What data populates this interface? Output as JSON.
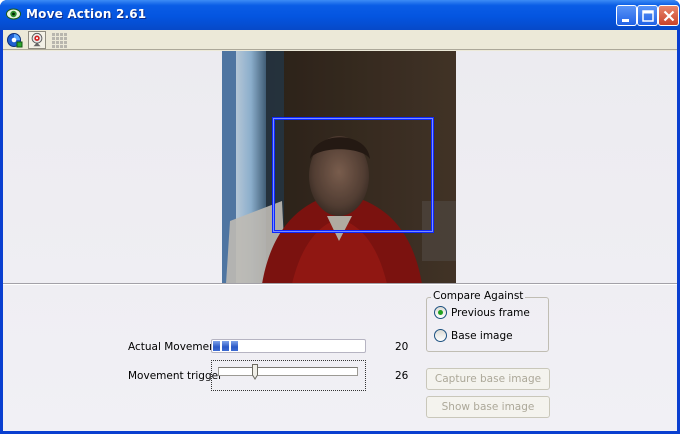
{
  "window": {
    "title": "Move Action 2.61",
    "icon": "eye-icon"
  },
  "title_buttons": {
    "minimize": "minimize-icon",
    "maximize": "maximize-icon",
    "close": "close-icon"
  },
  "toolbar": {
    "items": [
      "capture-icon",
      "webcam-icon",
      "grid-icon"
    ]
  },
  "movement": {
    "actual_label": "Actual Movement",
    "actual_value": "20",
    "trigger_label": "Movement trigger",
    "trigger_value": "26",
    "slider_level": 0.26,
    "progress_level": 0.2
  },
  "compare": {
    "title": "Compare Against",
    "options": [
      "Previous frame",
      "Base image"
    ],
    "selected": "Previous frame"
  },
  "buttons": {
    "capture": "Capture base image",
    "show": "Show base image"
  },
  "colors": {
    "titlebar": "#0a5de6",
    "selection_box": "#0d28ff",
    "progress_fill": "#2b59c6",
    "radio_dot": "#21a121"
  }
}
